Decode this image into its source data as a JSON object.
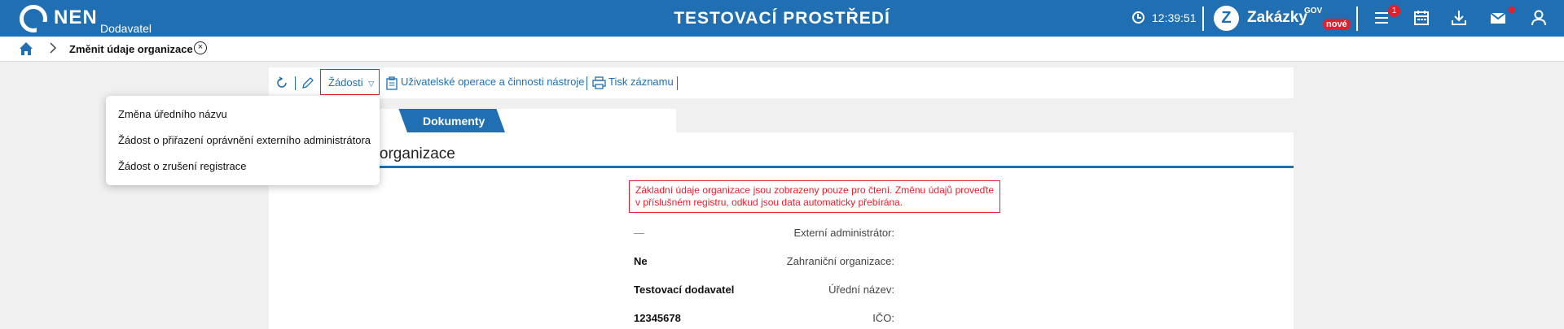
{
  "header": {
    "brand": "NEN",
    "brand_sub": "Dodavatel",
    "environment": "TESTOVACÍ PROSTŘEDÍ",
    "time": "12:39:51",
    "zakazky_label": "Zakázky",
    "zakazky_sup": "GOV",
    "zakazky_new": "nové",
    "menu_badge": "1",
    "brand_color": "#1f6fb2",
    "alert_color": "#e41e2a"
  },
  "breadcrumb": {
    "title": "Změnit údaje organizace",
    "close": "×"
  },
  "toolbar": {
    "zadosti_label": "Žádosti",
    "user_ops_label": "Uživatelské operace a činnosti nástroje",
    "print_label": "Tisk záznamu"
  },
  "tabs": {
    "active_label": "ace",
    "documents_label": "Dokumenty"
  },
  "section": {
    "title": "ace organizace"
  },
  "notice": "Základní údaje organizace jsou zobrazeny pouze pro čtení. Změnu údajů proveďte v příslušném registru, odkud jsou data automaticky přebírána.",
  "fields": [
    {
      "label": "Externí administrátor:",
      "value": "—"
    },
    {
      "label": "Zahraniční organizace:",
      "value": "Ne"
    },
    {
      "label": "Úřední název:",
      "value": "Testovací dodavatel"
    },
    {
      "label": "IČO:",
      "value": "12345678"
    }
  ],
  "dropdown": {
    "items": [
      "Změna úředního názvu",
      "Žádost o přiřazení oprávnění externího administrátora",
      "Žádost o zrušení registrace"
    ]
  }
}
